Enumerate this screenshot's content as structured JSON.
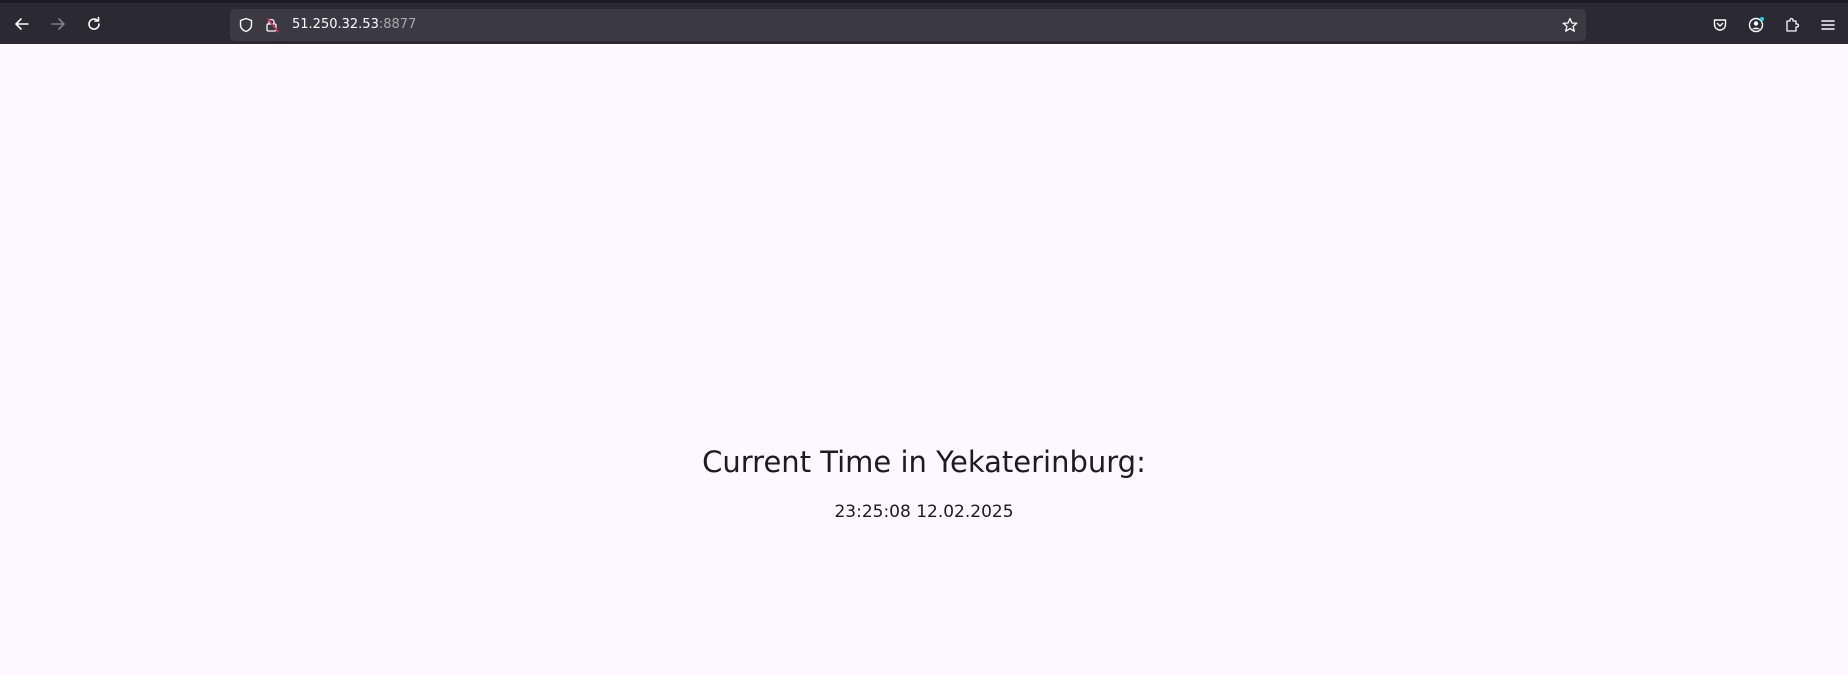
{
  "browser": {
    "url_host": "51.250.32.53",
    "url_port": ":8877",
    "icons": {
      "back": "arrow-left-icon",
      "forward": "arrow-right-icon",
      "reload": "reload-icon",
      "tracking": "shield-icon",
      "security": "lock-warning-icon",
      "bookmark": "star-icon",
      "pocket": "pocket-icon",
      "account": "account-icon",
      "extensions": "puzzle-icon",
      "menu": "hamburger-menu-icon"
    },
    "colors": {
      "toolbar": "#2b2a33",
      "urlbar": "#3b3a42",
      "text": "#fbfbfe"
    }
  },
  "page": {
    "heading": "Current Time in Yekaterinburg:",
    "time_value": "23:25:08 12.02.2025",
    "colors": {
      "background": "#fdf7ff",
      "text": "#1d1b20"
    }
  }
}
